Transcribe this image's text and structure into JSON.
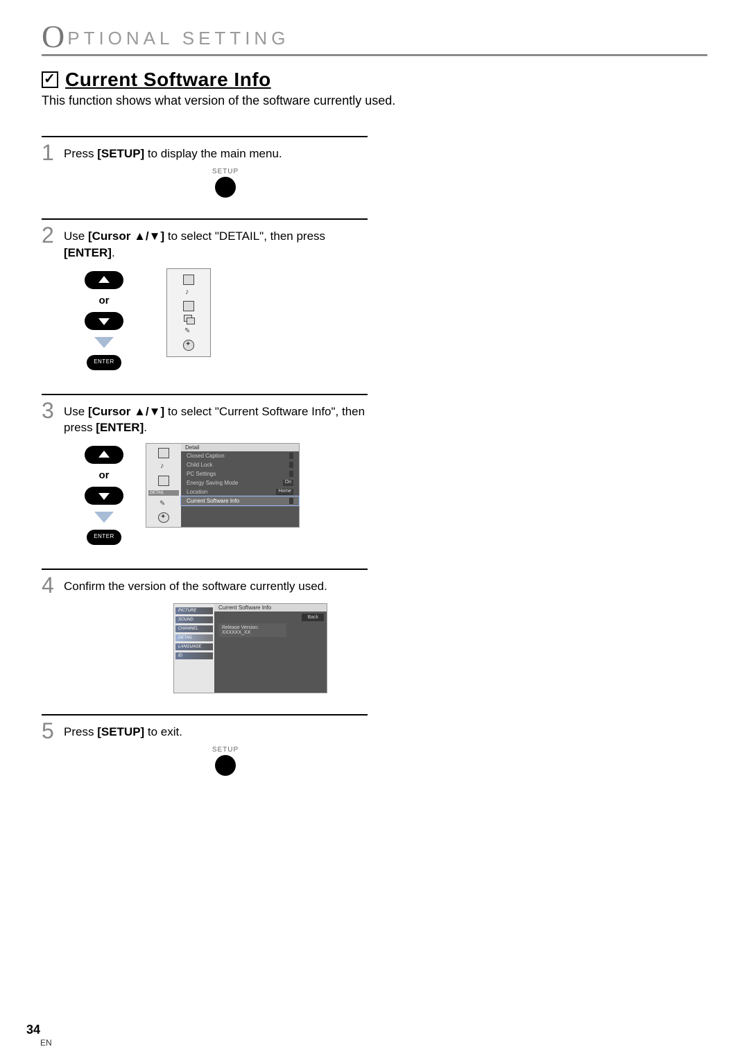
{
  "header": {
    "cap": "O",
    "rest": "PTIONAL  SETTING"
  },
  "section": {
    "title": "Current Software Info",
    "description": "This function shows what version of the software currently used."
  },
  "steps": {
    "s1": {
      "num": "1",
      "pre": "Press ",
      "key": "[SETUP]",
      "post": " to display the main menu.",
      "setup_label": "SETUP"
    },
    "s2": {
      "num": "2",
      "pre": "Use ",
      "key": "[Cursor ▲/▼]",
      "mid": " to select \"DETAIL\", then press ",
      "key2": "[ENTER]",
      "tail": ".",
      "or": "or",
      "enter": "ENTER"
    },
    "s3": {
      "num": "3",
      "pre": "Use ",
      "key": "[Cursor ▲/▼]",
      "mid": " to select \"Current Software Info\", then press ",
      "key2": "[ENTER]",
      "tail": ".",
      "or": "or",
      "enter": "ENTER",
      "menu": {
        "title": "Detail",
        "items": [
          {
            "label": "Closed Caption",
            "value": ""
          },
          {
            "label": "Child Lock",
            "value": ""
          },
          {
            "label": "PC Settings",
            "value": ""
          },
          {
            "label": "Energy Saving Mode",
            "value": "On"
          },
          {
            "label": "Location",
            "value": "Home"
          },
          {
            "label": "Current Software Info",
            "value": ""
          }
        ],
        "sidebar_tab": "DETAIL"
      }
    },
    "s4": {
      "num": "4",
      "text": "Confirm the version of the software currently used.",
      "menu": {
        "title": "Current Software Info",
        "back": "Back",
        "release_label": "Release Version:",
        "release_value": "XXXXXX_XX",
        "tabs": [
          "PICTURE",
          "SOUND",
          "CHANNEL",
          "DETAIL",
          "LANGUAGE",
          "ID"
        ]
      }
    },
    "s5": {
      "num": "5",
      "pre": "Press ",
      "key": "[SETUP]",
      "post": " to exit.",
      "setup_label": "SETUP"
    }
  },
  "footer": {
    "page": "34",
    "lang": "EN"
  }
}
